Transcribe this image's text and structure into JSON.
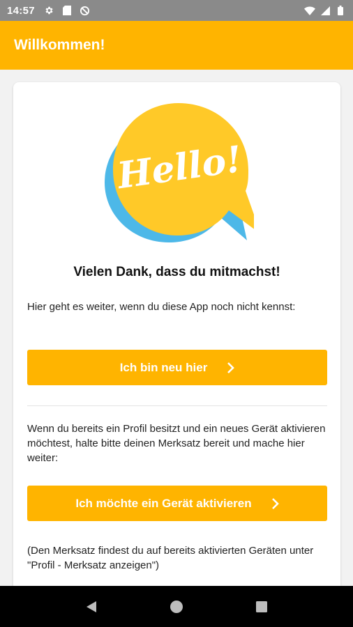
{
  "status_bar": {
    "time": "14:57",
    "left_icons": [
      "gear-icon",
      "sd-card-icon",
      "sync-off-icon"
    ],
    "right_icons": [
      "wifi-icon",
      "signal-icon",
      "battery-icon"
    ]
  },
  "app_bar": {
    "title": "Willkommen!",
    "color": "#FFB400"
  },
  "card": {
    "illustration": {
      "text": "Hello!",
      "bubble_color": "#FFC928",
      "shadow_color": "#4DB8E8"
    },
    "headline": "Vielen Dank, dass du mitmachst!",
    "intro_text": "Hier geht es weiter, wenn du diese App noch nicht kennst:",
    "new_button_label": "Ich bin neu hier",
    "existing_text": "Wenn du bereits ein Profil besitzt und ein neues Gerät aktivieren möchtest, halte bitte deinen Merksatz bereit und mache hier weiter:",
    "activate_button_label": "Ich möchte ein Gerät aktivieren",
    "hint_text": "(Den Merksatz findest du auf bereits aktivierten Geräten unter \"Profil - Merksatz anzeigen\")"
  },
  "nav_bar": {
    "buttons": [
      "back-icon",
      "home-icon",
      "recents-icon"
    ]
  }
}
